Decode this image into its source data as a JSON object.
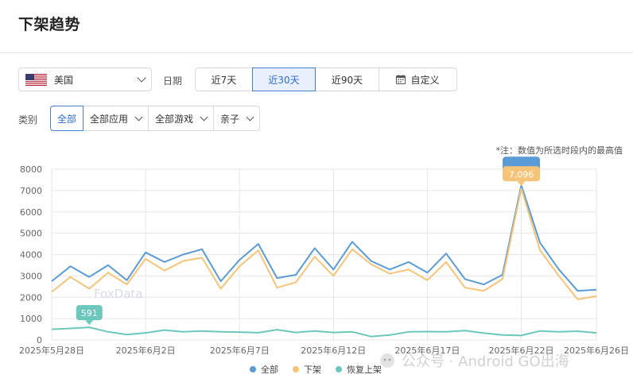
{
  "page": {
    "title": "下架趋势"
  },
  "filters": {
    "country": {
      "label": "美国",
      "flag": "us-flag"
    },
    "date_label": "日期",
    "date_ranges": [
      {
        "label": "近7天",
        "active": false
      },
      {
        "label": "近30天",
        "active": true
      },
      {
        "label": "近90天",
        "active": false
      },
      {
        "label": "自定义",
        "active": false,
        "icon": "calendar-icon"
      }
    ],
    "category_label": "类别",
    "categories": [
      {
        "label": "全部",
        "active": true,
        "dropdown": false
      },
      {
        "label": "全部应用",
        "active": false,
        "dropdown": true
      },
      {
        "label": "全部游戏",
        "active": false,
        "dropdown": true
      },
      {
        "label": "亲子",
        "active": false,
        "dropdown": true
      }
    ]
  },
  "note": "*注：数值为所选时段内的最高值",
  "watermarks": {
    "logo_text": "FoxData",
    "channel_text": "公众号 · Android GO出海"
  },
  "colors": {
    "all": "#5b9bd5",
    "removed": "#f5c478",
    "restored": "#6cc7bd",
    "accent": "#3a76d3"
  },
  "chart_data": {
    "type": "line",
    "x_tick_labels": [
      "2025年5月28日",
      "2025年6月2日",
      "2025年6月7日",
      "2025年6月12日",
      "2025年6月17日",
      "2025年6月22日",
      "2025年6月26日"
    ],
    "x": [
      "2025-05-28",
      "2025-05-29",
      "2025-05-30",
      "2025-05-31",
      "2025-06-01",
      "2025-06-02",
      "2025-06-03",
      "2025-06-04",
      "2025-06-05",
      "2025-06-06",
      "2025-06-07",
      "2025-06-08",
      "2025-06-09",
      "2025-06-10",
      "2025-06-11",
      "2025-06-12",
      "2025-06-13",
      "2025-06-14",
      "2025-06-15",
      "2025-06-16",
      "2025-06-17",
      "2025-06-18",
      "2025-06-19",
      "2025-06-20",
      "2025-06-21",
      "2025-06-22",
      "2025-06-23",
      "2025-06-24",
      "2025-06-25",
      "2025-06-26"
    ],
    "ylim": [
      0,
      8000
    ],
    "yticks": [
      0,
      1000,
      2000,
      3000,
      4000,
      5000,
      6000,
      7000,
      8000
    ],
    "grid": true,
    "legend_position": "bottom",
    "series": [
      {
        "name": "全部",
        "color": "#5b9bd5",
        "values": [
          2750,
          3450,
          2950,
          3500,
          2800,
          4100,
          3650,
          4000,
          4250,
          2750,
          3750,
          4500,
          2900,
          3050,
          4300,
          3300,
          4600,
          3700,
          3300,
          3650,
          3150,
          4050,
          2850,
          2600,
          3050,
          7250,
          4550,
          3300,
          2300,
          2350
        ]
      },
      {
        "name": "下架",
        "color": "#f5c478",
        "values": [
          2250,
          2950,
          2400,
          3150,
          2600,
          3800,
          3250,
          3700,
          3850,
          2400,
          3450,
          4200,
          2450,
          2700,
          3900,
          3000,
          4250,
          3550,
          3100,
          3300,
          2800,
          3650,
          2450,
          2300,
          2850,
          7096,
          4200,
          3000,
          1900,
          2050
        ]
      },
      {
        "name": "恢复上架",
        "color": "#6cc7bd",
        "values": [
          500,
          540,
          591,
          380,
          250,
          330,
          460,
          380,
          420,
          380,
          370,
          340,
          480,
          350,
          420,
          350,
          380,
          160,
          230,
          380,
          390,
          380,
          440,
          320,
          230,
          210,
          420,
          380,
          410,
          330
        ]
      }
    ],
    "annotations": [
      {
        "series": "下架",
        "label": "7,096"
      },
      {
        "series": "恢复上架",
        "label": "591"
      }
    ]
  }
}
